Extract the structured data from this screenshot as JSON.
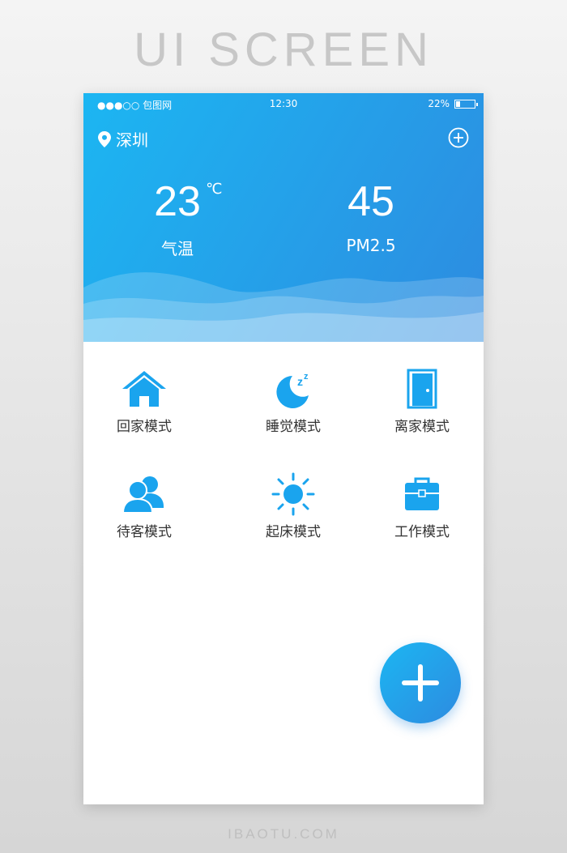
{
  "page": {
    "headline": "UI SCREEN",
    "footer": "IBAOTU.COM"
  },
  "status_bar": {
    "carrier": "●●●○○ 包图网",
    "time": "12:30",
    "battery": "22%",
    "battery_level": 0.22
  },
  "location": {
    "city": "深圳"
  },
  "weather": {
    "temperature": {
      "value": "23",
      "unit": "℃",
      "label": "气温"
    },
    "pm25": {
      "value": "45",
      "label": "PM2.5"
    }
  },
  "modes": [
    {
      "label": "回家模式",
      "icon": "home-icon"
    },
    {
      "label": "睡觉模式",
      "icon": "moon-sleep-icon"
    },
    {
      "label": "离家模式",
      "icon": "door-icon"
    },
    {
      "label": "待客模式",
      "icon": "guests-icon"
    },
    {
      "label": "起床模式",
      "icon": "sun-icon"
    },
    {
      "label": "工作模式",
      "icon": "briefcase-icon"
    }
  ],
  "colors": {
    "accent": "#1e9ef0",
    "header_start": "#1cb6f2",
    "header_end": "#2d8be0",
    "icon": "#1aa4ee"
  }
}
